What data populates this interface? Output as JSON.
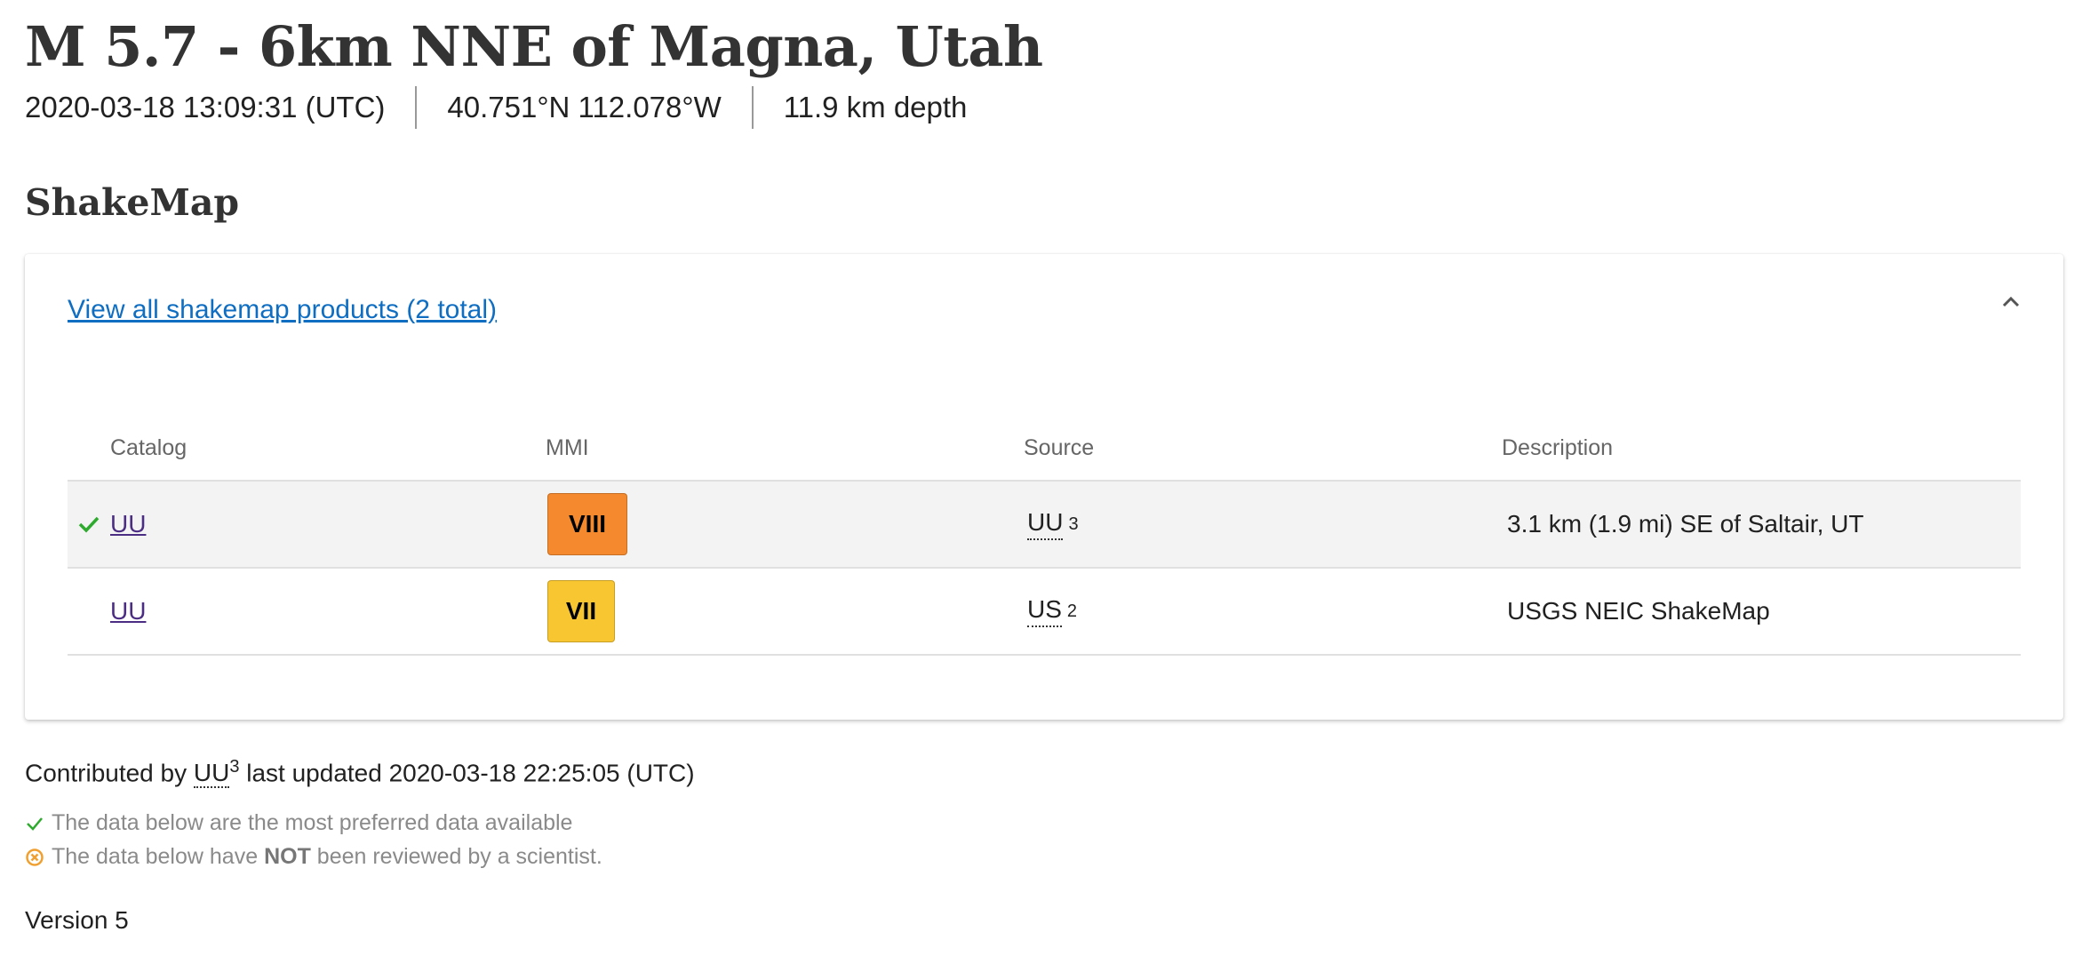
{
  "header": {
    "title": "M 5.7 - 6km NNE of Magna, Utah",
    "time": "2020-03-18 13:09:31 (UTC)",
    "location": "40.751°N 112.078°W",
    "depth": "11.9 km depth"
  },
  "section": {
    "title": "ShakeMap"
  },
  "panel": {
    "link_text": "View all shakemap products (2 total)",
    "columns": [
      "Catalog",
      "MMI",
      "Source",
      "Description"
    ],
    "rows": [
      {
        "preferred": true,
        "catalog": "UU",
        "mmi": "VIII",
        "mmi_color": "#f5892d",
        "source": "UU",
        "source_sup": "3",
        "description": "3.1 km (1.9 mi) SE of Saltair, UT"
      },
      {
        "preferred": false,
        "catalog": "UU",
        "mmi": "VII",
        "mmi_color": "#f8c630",
        "source": "US",
        "source_sup": "2",
        "description": "USGS NEIC ShakeMap"
      }
    ]
  },
  "footer": {
    "contrib_prefix": "Contributed by",
    "contrib_source": "UU",
    "contrib_sup": "3",
    "contrib_suffix": "last updated 2020-03-18 22:25:05 (UTC)",
    "note_preferred": "The data below are the most preferred data available",
    "note_review_prefix": "The data below have",
    "note_review_bold": "NOT",
    "note_review_suffix": "been reviewed by a scientist.",
    "version": "Version 5"
  },
  "colors": {
    "link": "#0f6ec2",
    "check": "#2eab2e",
    "warning": "#f0a030"
  }
}
